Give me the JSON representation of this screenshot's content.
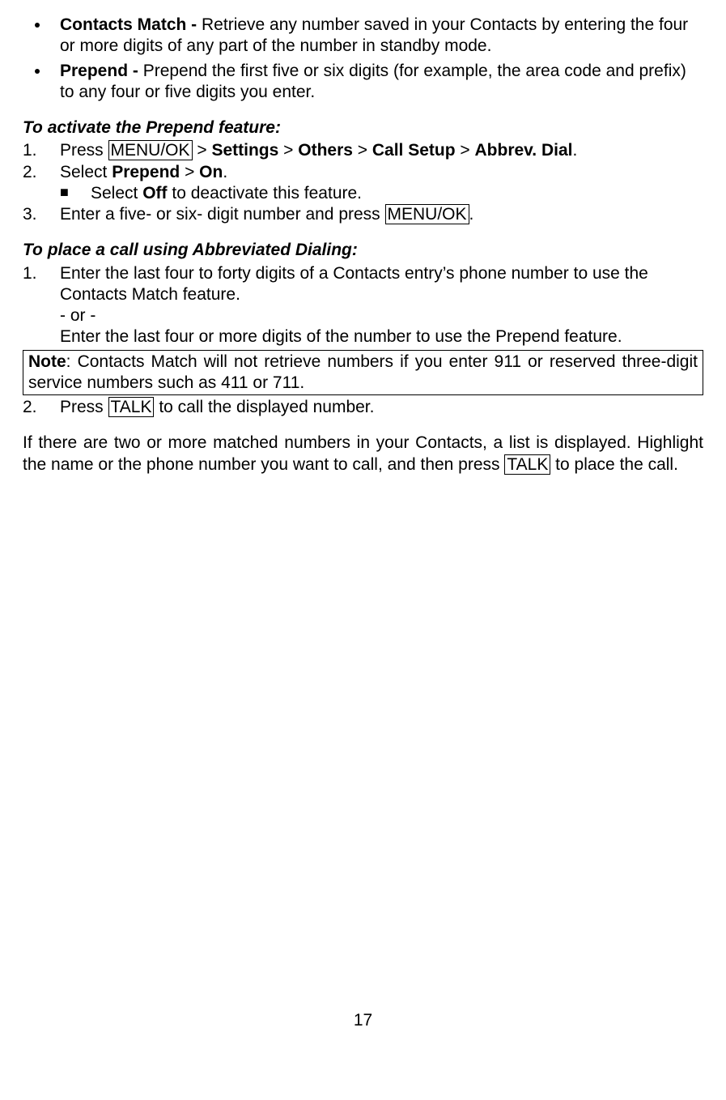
{
  "bullets": {
    "contacts_title": "Contacts Match - ",
    "contacts_text": "Retrieve any number saved in your Contacts by entering the four or more digits of any part of the number in standby mode.",
    "prepend_title": "Prepend - ",
    "prepend_text": "Prepend the first five or six digits (for example, the area code and prefix) to any four or five digits you enter."
  },
  "activate": {
    "heading": "To activate the Prepend feature:",
    "s1_pre": "Press ",
    "s1_key": "MENU/OK",
    "s1_gt1": " > ",
    "s1_b1": "Settings",
    "s1_gt2": " > ",
    "s1_b2": "Others",
    "s1_gt3": " > ",
    "s1_b3": "Call Setup",
    "s1_gt4": " > ",
    "s1_b4": "Abbrev. Dial",
    "s1_end": ".",
    "s2_pre": "Select ",
    "s2_b1": "Prepend",
    "s2_gt": " > ",
    "s2_b2": "On",
    "s2_end": ".",
    "s2_sub_pre": "Select ",
    "s2_sub_b": "Off",
    "s2_sub_post": " to deactivate this feature.",
    "s3_pre": "Enter a five- or six- digit number and press ",
    "s3_key": "MENU/OK",
    "s3_end": "."
  },
  "place": {
    "heading": "To place a call using Abbreviated Dialing:",
    "s1_a": "Enter the last four to forty digits of a Contacts entry’s phone number to use the Contacts Match feature.",
    "s1_or": "- or -",
    "s1_b": "Enter the last four or more digits of the number to use the Prepend feature.",
    "note_label": "Note",
    "note_text": ": Contacts Match will not retrieve numbers if you enter 911 or reserved three-digit service numbers such as 411 or 711.",
    "s2_pre": "Press ",
    "s2_key": "TALK",
    "s2_post": " to call the displayed number."
  },
  "footer": {
    "p1": "If there are two or more matched numbers in your Contacts, a list is displayed. Highlight the name or the phone number you want to call, and then press ",
    "key": "TALK",
    "p2": " to place the call."
  },
  "pagenum": "17"
}
